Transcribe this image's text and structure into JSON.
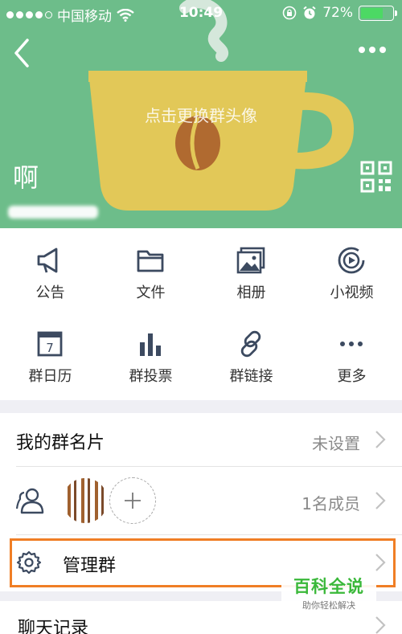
{
  "status_bar": {
    "carrier": "中国移动",
    "time": "10:49",
    "battery": "72%",
    "battery_level": 0.72,
    "battery_color": "#4cd964"
  },
  "header": {
    "change_avatar_text": "点击更换群头像",
    "group_name": "啊",
    "background_color": "#6dbd8a",
    "icons": [
      "back-icon",
      "more-icon",
      "qr-code-icon",
      "coffee-cup-icon"
    ]
  },
  "functions": [
    {
      "label": "公告",
      "icon": "megaphone-icon"
    },
    {
      "label": "文件",
      "icon": "folder-icon"
    },
    {
      "label": "相册",
      "icon": "photo-album-icon"
    },
    {
      "label": "小视频",
      "icon": "video-icon"
    },
    {
      "label": "群日历",
      "icon": "calendar-icon",
      "day": "7"
    },
    {
      "label": "群投票",
      "icon": "bar-chart-icon"
    },
    {
      "label": "群链接",
      "icon": "link-icon"
    },
    {
      "label": "更多",
      "icon": "more-dots-icon"
    }
  ],
  "list": {
    "card": {
      "title": "我的群名片",
      "value": "未设置"
    },
    "members": {
      "count": "1名成员"
    },
    "manage": {
      "title": "管理群"
    },
    "chat_history": {
      "title": "聊天记录"
    }
  },
  "watermark": {
    "title": "百科全说",
    "subtitle": "助你轻松解决"
  },
  "colors": {
    "highlight": "#f07e25",
    "watermark": "#3ab83a",
    "icon": "#3c4a60"
  }
}
